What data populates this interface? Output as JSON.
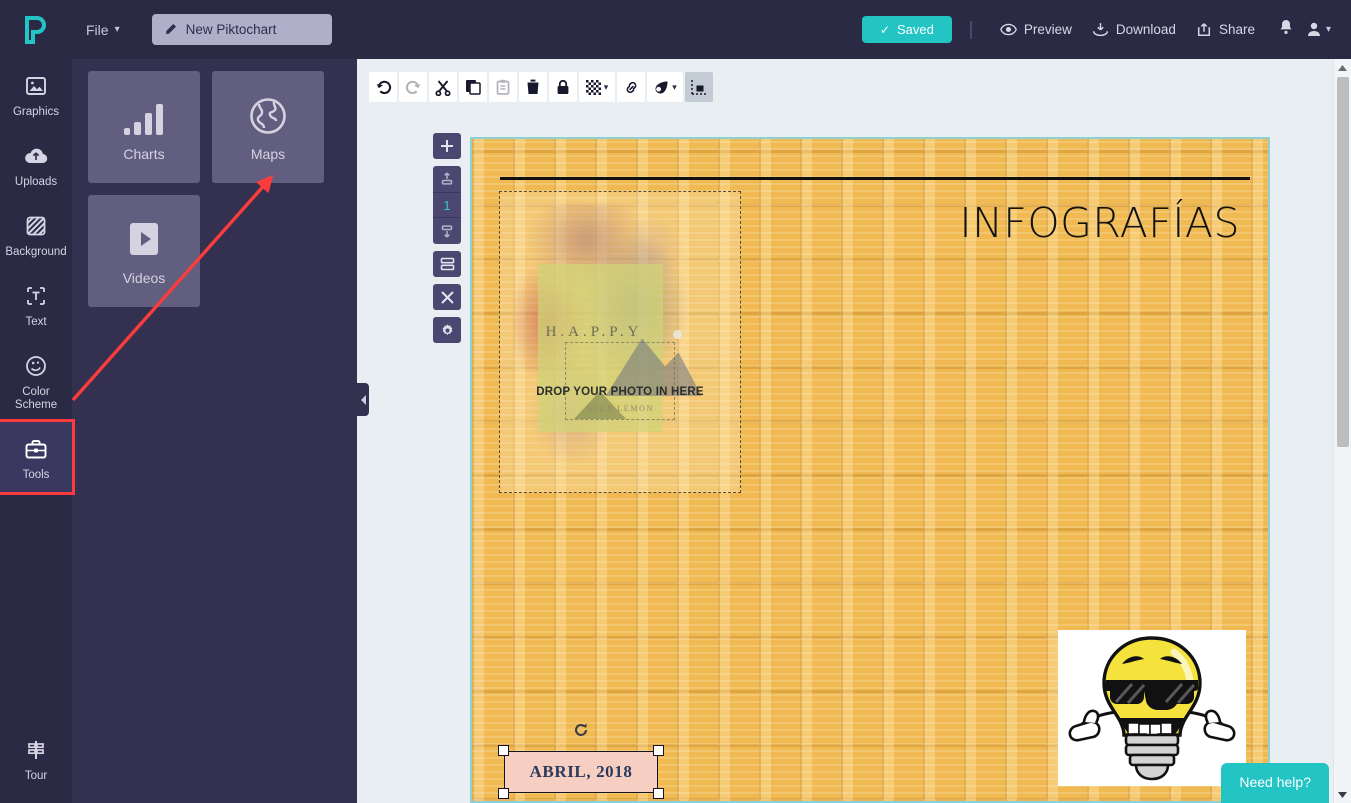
{
  "app": {
    "logo_icon": "piktochart-logo-icon",
    "file_menu": "File",
    "doc_title": "New Piktochart",
    "doc_title_icon": "pencil-icon"
  },
  "topbar": {
    "saved_label": "Saved",
    "saved_icon": "check-icon",
    "saved_color": "#22c4c4",
    "actions": [
      {
        "label": "Preview",
        "icon": "eye-icon"
      },
      {
        "label": "Download",
        "icon": "download-icon"
      },
      {
        "label": "Share",
        "icon": "share-icon"
      }
    ],
    "notification_icon": "bell-icon",
    "account_icon": "user-icon",
    "account_caret": "chevron-down-icon"
  },
  "sidebar": {
    "items": [
      {
        "label": "Graphics",
        "icon": "image-icon"
      },
      {
        "label": "Uploads",
        "icon": "cloud-upload-icon"
      },
      {
        "label": "Background",
        "icon": "hatch-square-icon"
      },
      {
        "label": "Text",
        "icon": "text-box-icon"
      },
      {
        "label": "Color\nScheme",
        "icon": "palette-icon"
      },
      {
        "label": "Tools",
        "icon": "toolbox-icon"
      }
    ],
    "bottom": {
      "label": "Tour",
      "icon": "tour-icon"
    },
    "active_item": "Tools",
    "highlight_color": "#fa3c3c"
  },
  "panel": {
    "cards": [
      {
        "label": "Charts",
        "icon": "bar-chart-icon"
      },
      {
        "label": "Maps",
        "icon": "globe-icon"
      },
      {
        "label": "Videos",
        "icon": "play-icon"
      }
    ],
    "collapse_icon": "chevron-left-icon"
  },
  "toolbar": {
    "buttons": [
      {
        "name": "undo",
        "icon": "undo-icon",
        "state": "enabled"
      },
      {
        "name": "redo",
        "icon": "redo-icon",
        "state": "disabled"
      },
      {
        "name": "cut",
        "icon": "scissors-icon",
        "state": "enabled"
      },
      {
        "name": "copy",
        "icon": "copy-icon",
        "state": "enabled"
      },
      {
        "name": "paste",
        "icon": "clipboard-icon",
        "state": "disabled"
      },
      {
        "name": "delete",
        "icon": "trash-icon",
        "state": "enabled"
      },
      {
        "name": "lock",
        "icon": "lock-icon",
        "state": "enabled"
      },
      {
        "name": "transparency",
        "icon": "checkerboard-icon",
        "state": "enabled",
        "caret": true
      },
      {
        "name": "link",
        "icon": "link-icon",
        "state": "enabled"
      },
      {
        "name": "mask",
        "icon": "mask-icon",
        "state": "enabled",
        "caret": true
      },
      {
        "name": "align",
        "icon": "align-icon",
        "state": "selected"
      }
    ]
  },
  "canvas_controls": {
    "add_block": {
      "icon": "plus-icon"
    },
    "move_up": {
      "icon": "move-block-up-icon"
    },
    "block_number": "1",
    "move_down": {
      "icon": "move-block-down-icon"
    },
    "duplicate_block": {
      "icon": "duplicate-block-icon"
    },
    "delete_block": {
      "icon": "close-icon"
    },
    "block_settings": {
      "icon": "gear-icon"
    },
    "accent_color": "#2ec9c9"
  },
  "canvas": {
    "border_color": "#8fd1d0",
    "background_color": "#f0b952",
    "title": "INFOGRAFÍAS",
    "photo_placeholder": {
      "drop_text": "DROP YOUR PHOTO IN HERE",
      "book_title": "H.A.P.P.Y",
      "byline": "ALEX LEMON"
    },
    "sticker": {
      "name": "lightbulb-sunglasses-thumbs-up-sticker"
    },
    "selected_element": {
      "text": "ABRIL, 2018",
      "fill_color": "#f6cfc2",
      "text_color": "#2a3a5c",
      "rotate_icon": "rotate-icon",
      "handles": 4
    }
  },
  "scrollbar": {
    "up_arrow_icon": "caret-up-icon",
    "down_arrow_icon": "caret-down-icon"
  },
  "help": {
    "label": "Need help?",
    "color": "#22c4c4"
  },
  "annotation": {
    "arrow_color": "#fa3c3c",
    "from": "Tools",
    "to": "Maps"
  }
}
